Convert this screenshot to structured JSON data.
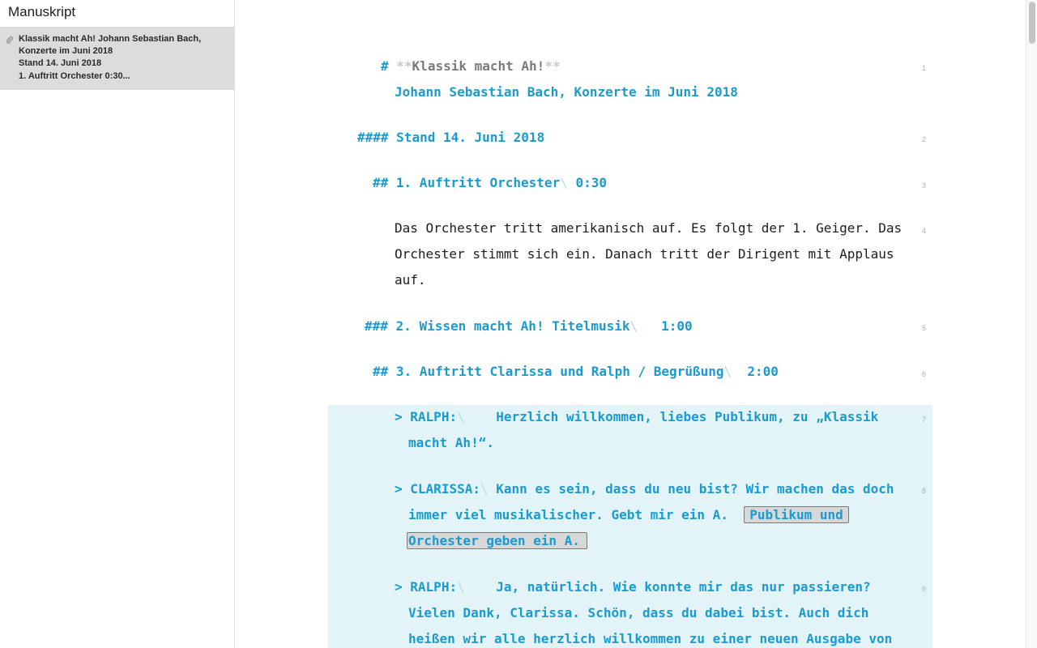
{
  "sidebar": {
    "title": "Manuskript",
    "item": {
      "icon": "paperclip-icon",
      "lines": [
        "Klassik macht Ah! Johann Sebastian Bach,",
        "Konzerte im Juni 2018",
        "Stand 14. Juni 2018",
        "1. Auftritt Orchester 0:30..."
      ]
    }
  },
  "editor": {
    "l1": {
      "prefix": "#",
      "stars_open": "**",
      "title": "Klassik macht Ah!",
      "stars_close": "**",
      "sub": "Johann Sebastian Bach, Konzerte im Juni 2018",
      "num": "1"
    },
    "l2": {
      "prefix": "####",
      "text": "Stand 14. Juni 2018",
      "num": "2"
    },
    "l3": {
      "prefix": "##",
      "text": "1. Auftritt Orchester",
      "slash": "\\",
      "time": "0:30",
      "num": "3"
    },
    "l4": {
      "lines": [
        "Das Orchester tritt amerikanisch auf. Es folgt der 1. Geiger. Das",
        "Orchester stimmt sich ein. Danach tritt der Dirigent mit Applaus",
        "auf."
      ],
      "num": "4"
    },
    "l5": {
      "prefix": "###",
      "text": "2. Wissen macht Ah! Titelmusik",
      "slash": "\\",
      "time": "1:00",
      "num": "5"
    },
    "l6": {
      "prefix": "##",
      "text": "3. Auftritt Clarissa und Ralph / Begrüßung",
      "slash": "\\",
      "time": "2:00",
      "num": "6"
    },
    "l7": {
      "prefix": ">",
      "speaker": "RALPH:",
      "slash": "\\",
      "text": "Herzlich willkommen, liebes Publikum, zu „Klassik",
      "text2": "macht Ah!“.",
      "num": "7"
    },
    "l8": {
      "prefix": ">",
      "speaker": "CLARISSA:",
      "slash": "\\",
      "text": "Kann es sein, dass du neu bist? Wir machen das doch",
      "text2": "immer viel musikalischer. Gebt mir ein A.",
      "hl1": "Publikum und",
      "hl2": "Orchester geben ein A.",
      "num": "8"
    },
    "l9": {
      "prefix": ">",
      "speaker": "RALPH:",
      "slash": "\\",
      "text": "Ja, natürlich. Wie konnte mir das nur passieren?",
      "text2": "Vielen Dank, Clarissa. Schön, dass du dabei bist. Auch dich",
      "text3": "heißen wir alle herzlich willkommen zu einer neuen Ausgabe von",
      "num": "9"
    }
  },
  "colors": {
    "heading": "#1a9bcf",
    "quote_bg": "#e3f4f9",
    "sidebar_selected": "#dcdcdc"
  }
}
